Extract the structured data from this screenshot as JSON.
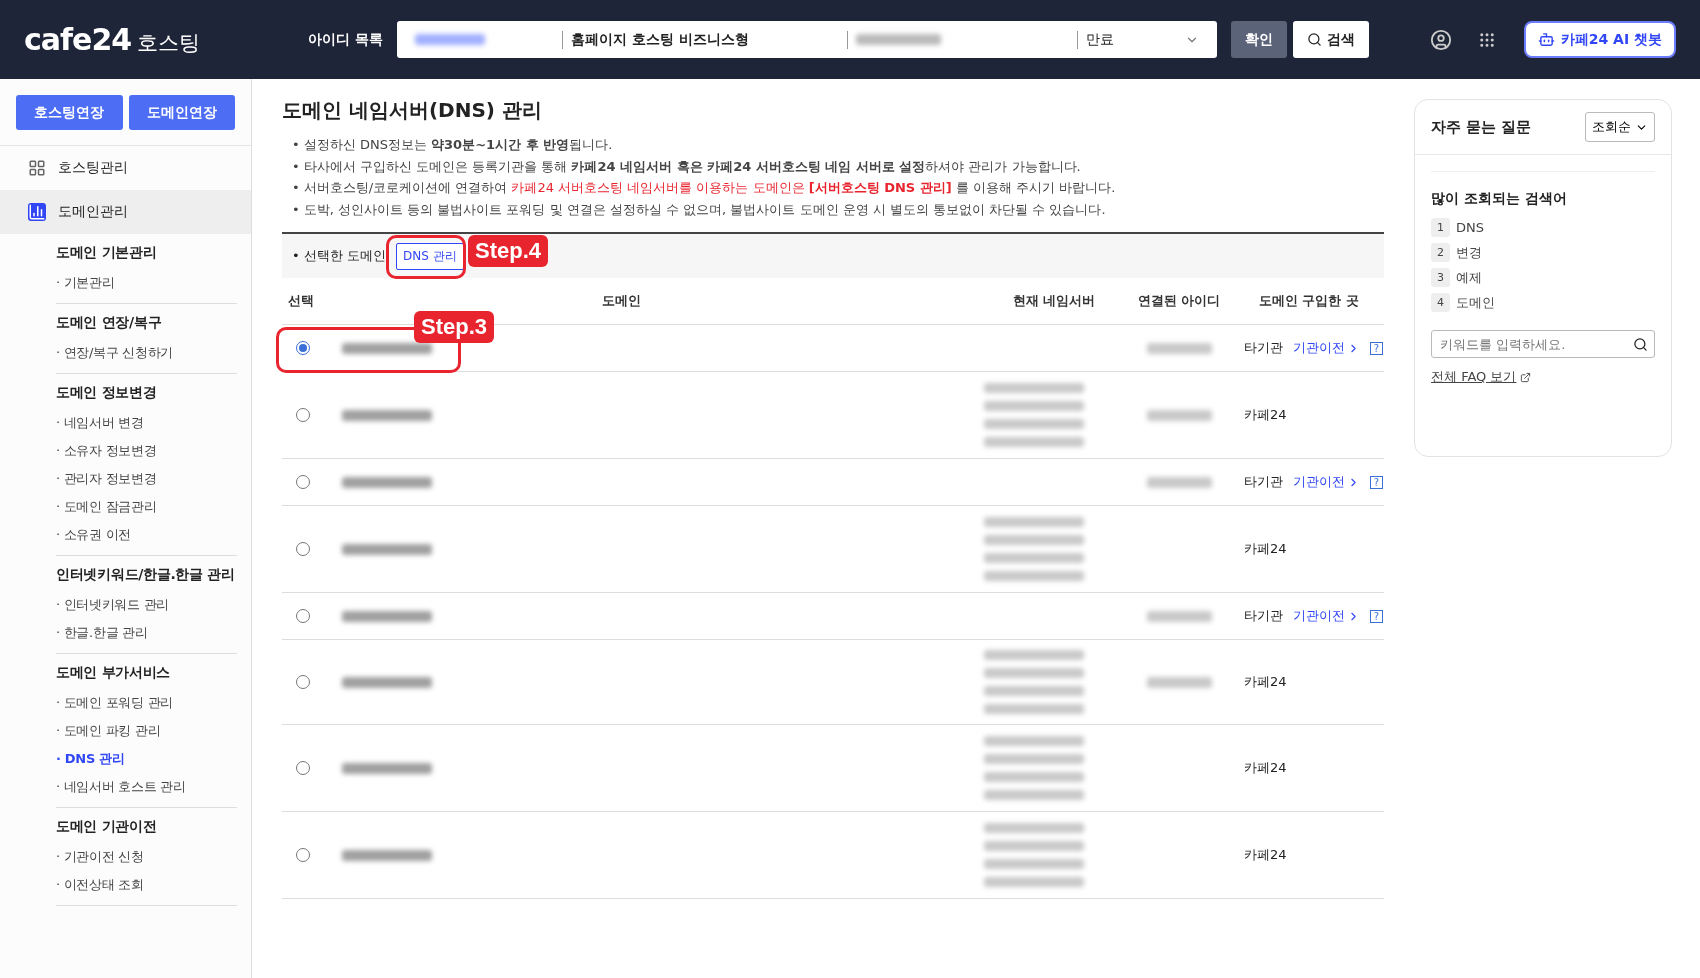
{
  "header": {
    "logo": "cafe24",
    "logo_suffix": "호스팅",
    "id_label": "아이디 목록",
    "selector": {
      "id_blurred": true,
      "product": "홈페이지 호스팅 비즈니스형",
      "domain_blurred": true,
      "status": "만료"
    },
    "confirm": "확인",
    "search": "검색",
    "chatbot": "카페24 AI 챗봇"
  },
  "sidebar": {
    "buttons": [
      "호스팅연장",
      "도메인연장"
    ],
    "menus": [
      {
        "label": "호스팅관리",
        "selected": false
      },
      {
        "label": "도메인관리",
        "selected": true
      }
    ],
    "groups": [
      {
        "title": "도메인 기본관리",
        "items": [
          {
            "label": "· 기본관리",
            "selected": false
          }
        ]
      },
      {
        "title": "도메인 연장/복구",
        "items": [
          {
            "label": "· 연장/복구 신청하기",
            "selected": false
          }
        ]
      },
      {
        "title": "도메인 정보변경",
        "items": [
          {
            "label": "· 네임서버 변경",
            "selected": false
          },
          {
            "label": "· 소유자 정보변경",
            "selected": false
          },
          {
            "label": "· 관리자 정보변경",
            "selected": false
          },
          {
            "label": "· 도메인 잠금관리",
            "selected": false
          },
          {
            "label": "· 소유권 이전",
            "selected": false
          }
        ]
      },
      {
        "title": "인터넷키워드/한글.한글 관리",
        "items": [
          {
            "label": "· 인터넷키워드 관리",
            "selected": false
          },
          {
            "label": "· 한글.한글 관리",
            "selected": false
          }
        ]
      },
      {
        "title": "도메인 부가서비스",
        "items": [
          {
            "label": "· 도메인 포워딩 관리",
            "selected": false
          },
          {
            "label": "· 도메인 파킹 관리",
            "selected": false
          },
          {
            "label": "· DNS 관리",
            "selected": true
          },
          {
            "label": "· 네임서버 호스트 관리",
            "selected": false
          }
        ]
      },
      {
        "title": "도메인 기관이전",
        "items": [
          {
            "label": "· 기관이전 신청",
            "selected": false
          },
          {
            "label": "· 이전상태 조회",
            "selected": false
          }
        ]
      }
    ]
  },
  "main": {
    "title": "도메인 네임서버(DNS) 관리",
    "notes": [
      {
        "text": "• 설정하신 DNS정보는 **약30분~1시간 후 반영**됩니다."
      },
      {
        "text": "• 타사에서 구입하신 도메인은 등록기관을 통해 **카페24 네임서버 혹은 카페24 서버호스팅 네임 서버로 설정**하셔야 관리가 가능합니다."
      },
      {
        "text": "• 서버호스팅/코로케이션에 연결하여 ",
        "red": "카페24 서버호스팅 네임서버를 이용하는 도메인은 **[서버호스팅 DNS 관리]**",
        "after": " 를 이용해 주시기 바랍니다."
      },
      {
        "text": "• 도박, 성인사이트 등의 불법사이트 포워딩 및 연결은 설정하실 수 없으며, 불법사이트 도메인 운영 시 별도의 통보없이 차단될 수 있습니다."
      }
    ],
    "selected_label": "• 선택한 도메인",
    "dns_button": "DNS 관리",
    "step4": "Step.4",
    "step3": "Step.3",
    "columns": [
      "선택",
      "도메인",
      "현재 네임서버",
      "연결된 아이디",
      "도메인 구입한 곳"
    ],
    "rows": [
      {
        "selected": true,
        "domain_blurred": true,
        "nameservers": [],
        "id_blurred": true,
        "registrar": "타기관",
        "transfer": "기관이전",
        "help": "?"
      },
      {
        "selected": false,
        "domain_blurred": true,
        "nameservers": [
          {
            "blurred": true
          },
          {
            "blurred": true
          },
          {
            "blurred": true
          },
          {
            "blurred": true
          }
        ],
        "id_blurred": true,
        "registrar": "카페24"
      },
      {
        "selected": false,
        "domain_blurred": true,
        "nameservers": [],
        "id_blurred": true,
        "registrar": "타기관",
        "transfer": "기관이전",
        "help": "?"
      },
      {
        "selected": false,
        "domain_blurred": true,
        "nameservers": [
          {
            "blurred": true
          },
          {
            "blurred": true
          },
          {
            "blurred": true
          },
          {
            "blurred": true
          }
        ],
        "registrar": "카페24"
      },
      {
        "selected": false,
        "domain_blurred": true,
        "nameservers": [],
        "id_blurred": true,
        "registrar": "타기관",
        "transfer": "기관이전",
        "help": "?"
      },
      {
        "selected": false,
        "domain_blurred": true,
        "nameservers": [
          {
            "blurred": true
          },
          {
            "blurred": true
          },
          {
            "blurred": true
          },
          {
            "blurred": true
          }
        ],
        "id_blurred": true,
        "registrar": "카페24"
      },
      {
        "selected": false,
        "domain_blurred": true,
        "nameservers": [
          {
            "blurred": true
          },
          {
            "blurred": true
          },
          {
            "blurred": true
          },
          {
            "blurred": true
          }
        ],
        "registrar": "카페24"
      },
      {
        "selected": false,
        "domain_blurred": true,
        "nameservers": [
          {
            "blurred": true
          },
          {
            "blurred": true
          },
          {
            "blurred": true
          },
          {
            "blurred": true
          }
        ],
        "registrar": "카페24"
      }
    ]
  },
  "faq": {
    "title": "자주 묻는 질문",
    "sort": "조회순",
    "popular_title": "많이 조회되는 검색어",
    "keywords": [
      {
        "rank": "1",
        "label": "DNS"
      },
      {
        "rank": "2",
        "label": "변경"
      },
      {
        "rank": "3",
        "label": "예제"
      },
      {
        "rank": "4",
        "label": "도메인"
      }
    ],
    "search_placeholder": "키워드를 입력하세요.",
    "all_link": "전체 FAQ 보기"
  }
}
